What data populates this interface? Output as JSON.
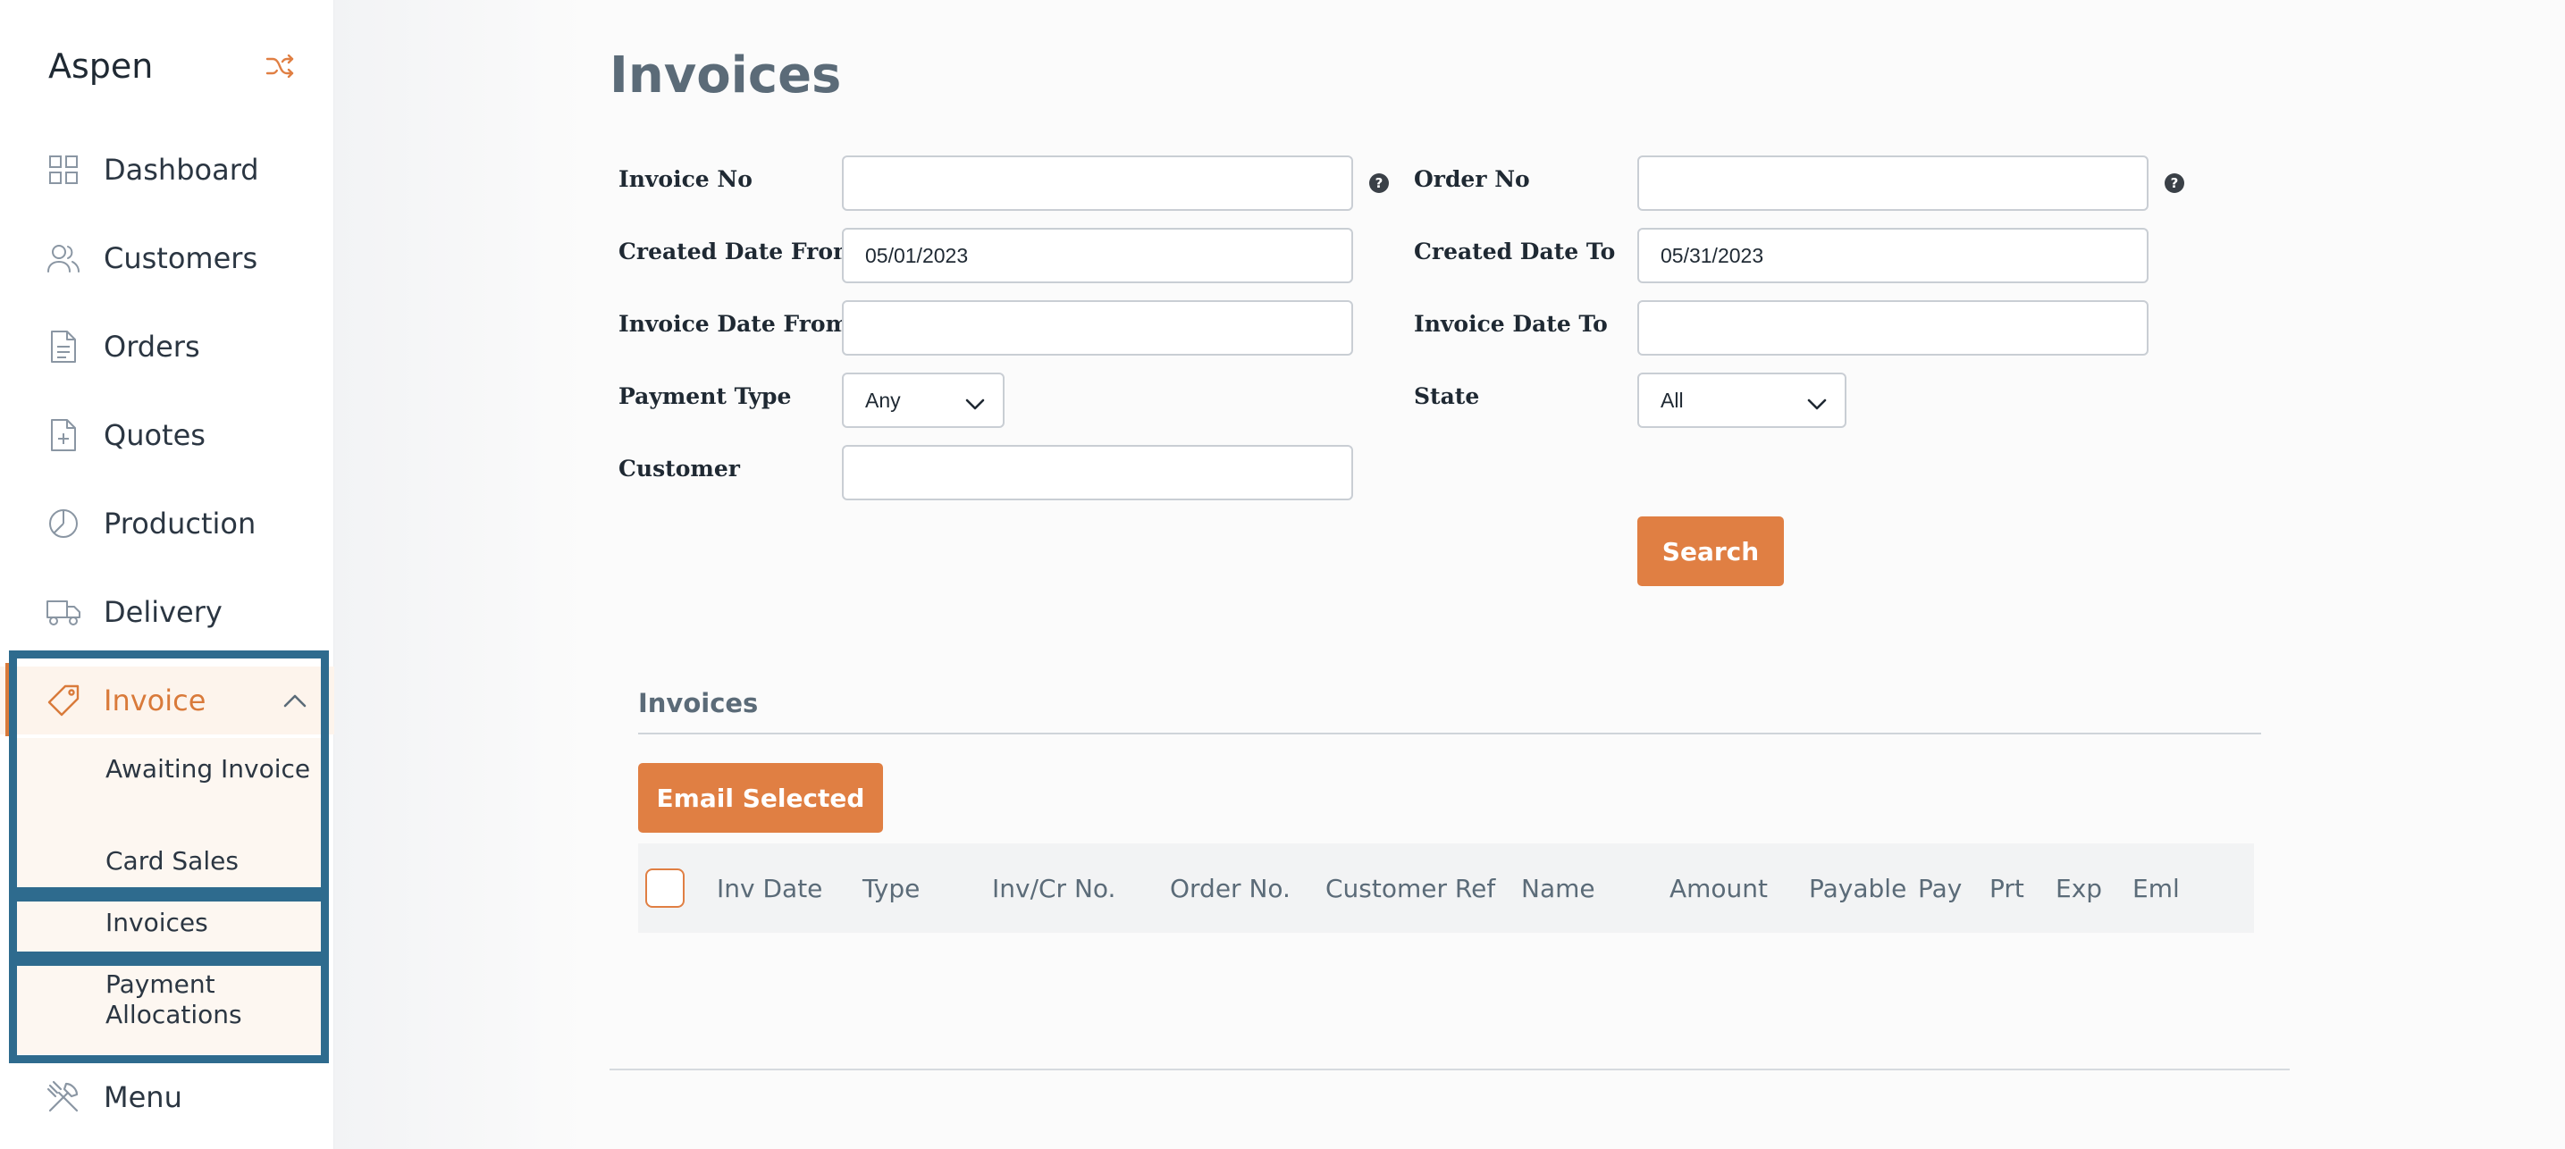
{
  "app": {
    "brand": "Aspen",
    "accent_color": "#e07f43",
    "highlight_color": "#2e6b8e"
  },
  "sidebar": {
    "items": [
      {
        "label": "Dashboard",
        "icon": "grid-icon"
      },
      {
        "label": "Customers",
        "icon": "users-icon"
      },
      {
        "label": "Orders",
        "icon": "document-icon"
      },
      {
        "label": "Quotes",
        "icon": "file-plus-icon"
      },
      {
        "label": "Production",
        "icon": "pie-chart-icon"
      },
      {
        "label": "Delivery",
        "icon": "truck-icon"
      },
      {
        "label": "Invoice",
        "icon": "tag-icon",
        "active": true
      },
      {
        "label": "Menu",
        "icon": "utensils-icon"
      }
    ],
    "invoice_submenu": [
      {
        "label": "Awaiting Invoice"
      },
      {
        "label": "Card Sales"
      },
      {
        "label": "Invoices"
      },
      {
        "label": "Payment Allocations"
      }
    ]
  },
  "page": {
    "title": "Invoices"
  },
  "filters": {
    "invoice_no": {
      "label": "Invoice No",
      "value": ""
    },
    "order_no": {
      "label": "Order No",
      "value": ""
    },
    "created_date_from": {
      "label": "Created Date From",
      "value": "05/01/2023"
    },
    "created_date_to": {
      "label": "Created Date To",
      "value": "05/31/2023"
    },
    "invoice_date_from": {
      "label": "Invoice Date From",
      "value": ""
    },
    "invoice_date_to": {
      "label": "Invoice Date To",
      "value": ""
    },
    "payment_type": {
      "label": "Payment Type",
      "value": "Any"
    },
    "state": {
      "label": "State",
      "value": "All"
    },
    "customer": {
      "label": "Customer",
      "value": ""
    },
    "help_glyph": "?",
    "search_label": "Search"
  },
  "results": {
    "section_title": "Invoices",
    "email_selected_label": "Email Selected",
    "columns": [
      "Inv Date",
      "Type",
      "Inv/Cr No.",
      "Order No.",
      "Customer Ref",
      "Name",
      "Amount",
      "Payable",
      "Pay",
      "Prt",
      "Exp",
      "Eml"
    ]
  }
}
